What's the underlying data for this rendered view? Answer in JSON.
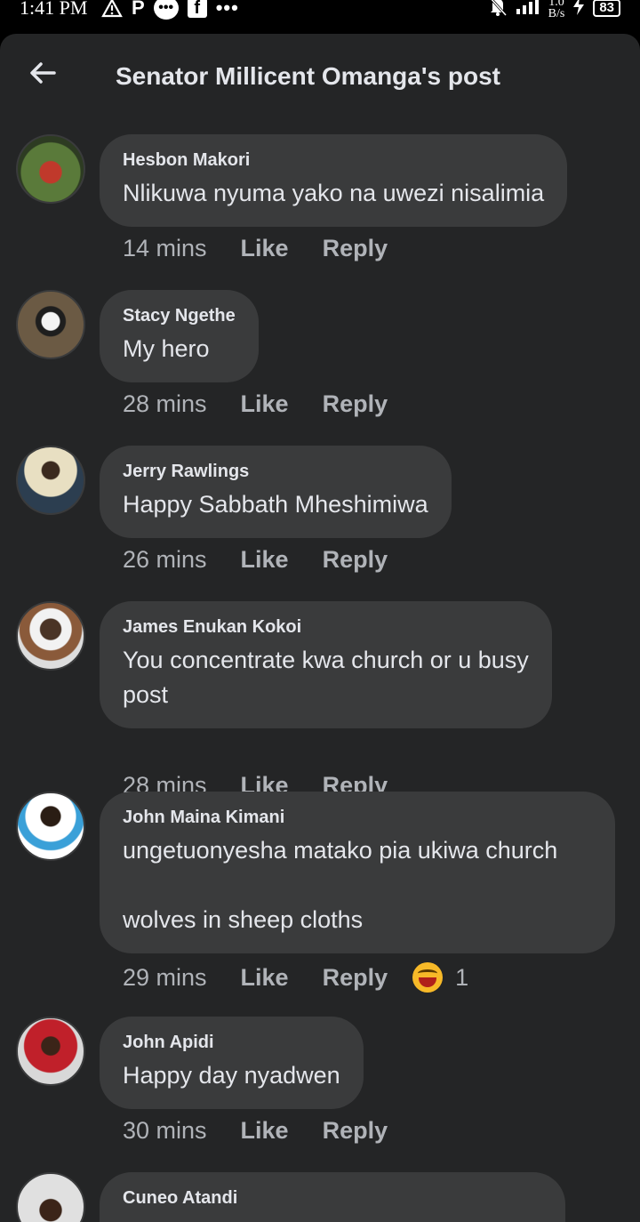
{
  "status": {
    "time": "1:41 PM",
    "net_speed_top": "1.0",
    "net_speed_bottom": "B/s",
    "battery": "83"
  },
  "header": {
    "title": "Senator Millicent Omanga's post",
    "back_icon": "arrow-left-icon"
  },
  "comments": [
    {
      "author": "Hesbon Makori",
      "text": "Nlikuwa nyuma yako na uwezi nisalimia",
      "time": "14 mins",
      "like": "Like",
      "reply": "Reply"
    },
    {
      "author": "Stacy Ngethe",
      "text": "My hero",
      "time": "28 mins",
      "like": "Like",
      "reply": "Reply"
    },
    {
      "author": "Jerry Rawlings",
      "text": "Happy Sabbath Mheshimiwa",
      "time": "26 mins",
      "like": "Like",
      "reply": "Reply"
    },
    {
      "author": "James Enukan Kokoi",
      "text": "You concentrate kwa church or u busy\npost",
      "time": "28 mins",
      "like": "Like",
      "reply": "Reply"
    },
    {
      "author": "John Maina Kimani",
      "text": "ungetuonyesha matako pia ukiwa church\n\nwolves in sheep cloths",
      "time": "29 mins",
      "like": "Like",
      "reply": "Reply",
      "reaction_icon": "haha-emoji-icon",
      "reaction_count": "1"
    },
    {
      "author": "John Apidi",
      "text": "Happy day nyadwen",
      "time": "30 mins",
      "like": "Like",
      "reply": "Reply"
    },
    {
      "author": "Cuneo Atandi",
      "text": "",
      "time": "",
      "like": "",
      "reply": ""
    }
  ],
  "colors": {
    "background": "#242526",
    "bubble": "#3a3b3c",
    "text": "#e4e6eb",
    "secondary_text": "#b0b3b8"
  }
}
